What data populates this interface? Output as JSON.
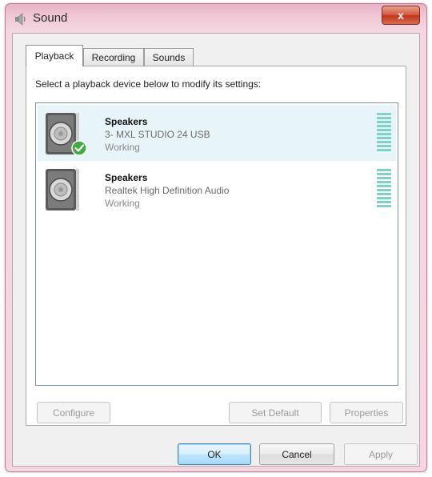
{
  "window": {
    "title": "Sound",
    "close_label": "x"
  },
  "tabs": [
    {
      "label": "Playback",
      "active": true
    },
    {
      "label": "Recording",
      "active": false
    },
    {
      "label": "Sounds",
      "active": false
    }
  ],
  "playback": {
    "instruction": "Select a playback device below to modify its settings:",
    "devices": [
      {
        "name": "Speakers",
        "description": "3- MXL STUDIO 24 USB",
        "status": "Working",
        "is_default": true,
        "selected": true
      },
      {
        "name": "Speakers",
        "description": "Realtek High Definition Audio",
        "status": "Working",
        "is_default": false,
        "selected": false
      }
    ],
    "buttons": {
      "configure": "Configure",
      "set_default": "Set Default",
      "properties": "Properties"
    }
  },
  "dialog_buttons": {
    "ok": "OK",
    "cancel": "Cancel",
    "apply": "Apply"
  },
  "colors": {
    "title_bar": "#efc7d4",
    "selection": "#e7f5fb",
    "meter": "#7fd3c4",
    "default_check": "#3fae3f"
  },
  "icons": {
    "window": "speaker-icon",
    "device": "speaker-icon",
    "default_marker": "checkmark-icon"
  }
}
